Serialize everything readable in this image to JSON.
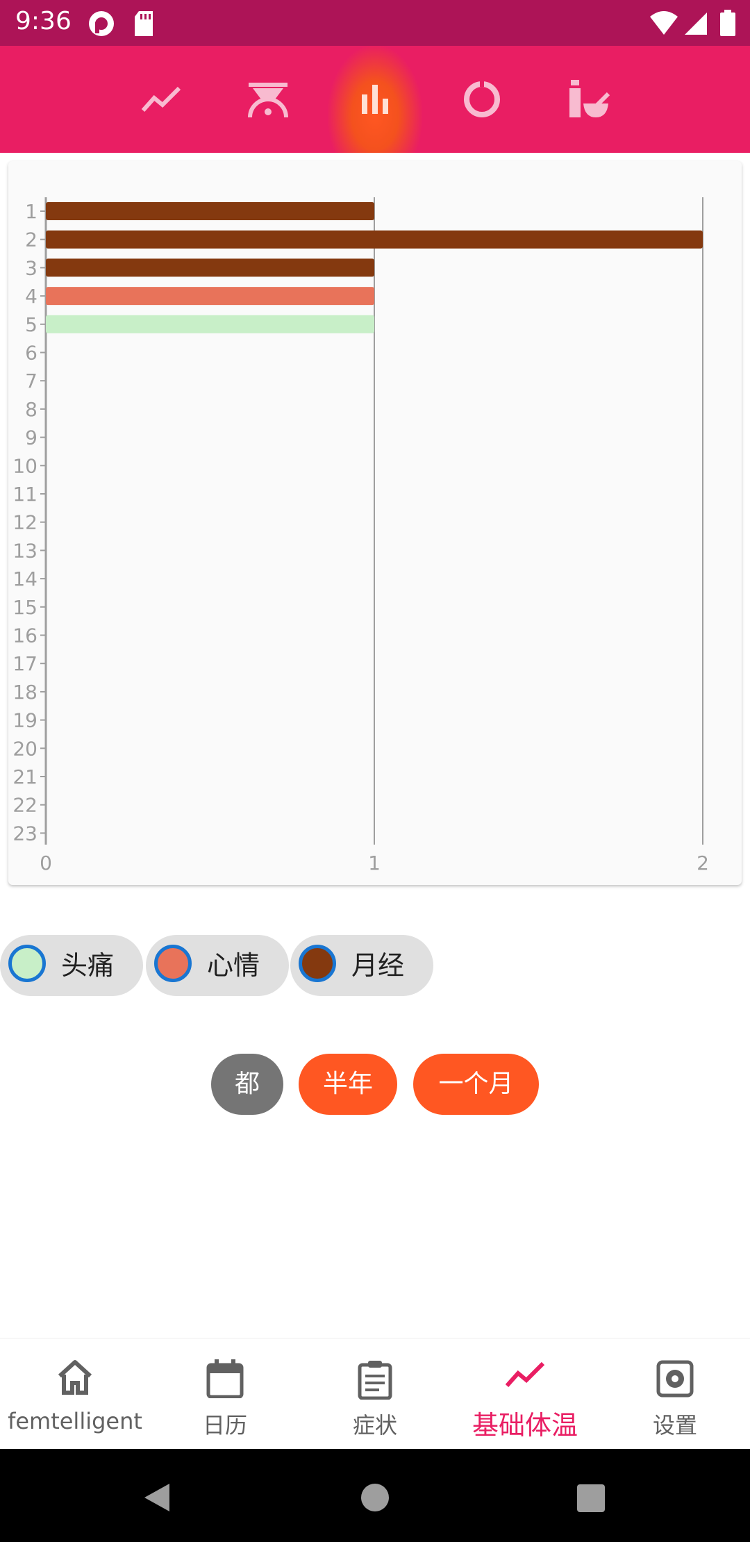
{
  "status_bar": {
    "time": "9:36"
  },
  "top_tabs": [
    {
      "icon": "line-chart-icon"
    },
    {
      "icon": "thermometer-gauge-icon"
    },
    {
      "icon": "bar-chart-icon",
      "active": true
    },
    {
      "icon": "donut-chart-icon"
    },
    {
      "icon": "mortar-pestle-icon"
    }
  ],
  "chart_data": {
    "type": "bar",
    "orientation": "horizontal",
    "categories": [
      "1",
      "2",
      "3",
      "4",
      "5",
      "6",
      "7",
      "8",
      "9",
      "10",
      "11",
      "12",
      "13",
      "14",
      "15",
      "16",
      "17",
      "18",
      "19",
      "20",
      "21",
      "22",
      "23"
    ],
    "bars": [
      {
        "category": "1",
        "value": 1,
        "color": "#84390F"
      },
      {
        "category": "2",
        "value": 2,
        "color": "#84390F"
      },
      {
        "category": "3",
        "value": 1,
        "color": "#84390F"
      },
      {
        "category": "4",
        "value": 1,
        "color": "#E8735A"
      },
      {
        "category": "5",
        "value": 1,
        "color": "#C8EFC8"
      }
    ],
    "x_ticks": [
      "0",
      "1",
      "2"
    ],
    "xlim": [
      0,
      2
    ],
    "grid": "vertical",
    "legend": "bottom-left"
  },
  "legend": [
    {
      "label": "头痛",
      "color": "#C8EFC8"
    },
    {
      "label": "心情",
      "color": "#E8735A"
    },
    {
      "label": "月经",
      "color": "#84390F"
    }
  ],
  "range_buttons": [
    {
      "label": "都",
      "color": "#757575"
    },
    {
      "label": "半年",
      "color": "#FF5722"
    },
    {
      "label": "一个月",
      "color": "#FF5722"
    }
  ],
  "bottom_nav": [
    {
      "label": "femtelligent",
      "icon": "home-icon"
    },
    {
      "label": "日历",
      "icon": "calendar-icon"
    },
    {
      "label": "症状",
      "icon": "clipboard-icon"
    },
    {
      "label": "基础体温",
      "icon": "trending-line-icon",
      "active": true
    },
    {
      "label": "设置",
      "icon": "settings-icon"
    }
  ],
  "colors": {
    "accent": "#E91E63",
    "status_bar": "#AD1457",
    "orange": "#FF5722"
  }
}
